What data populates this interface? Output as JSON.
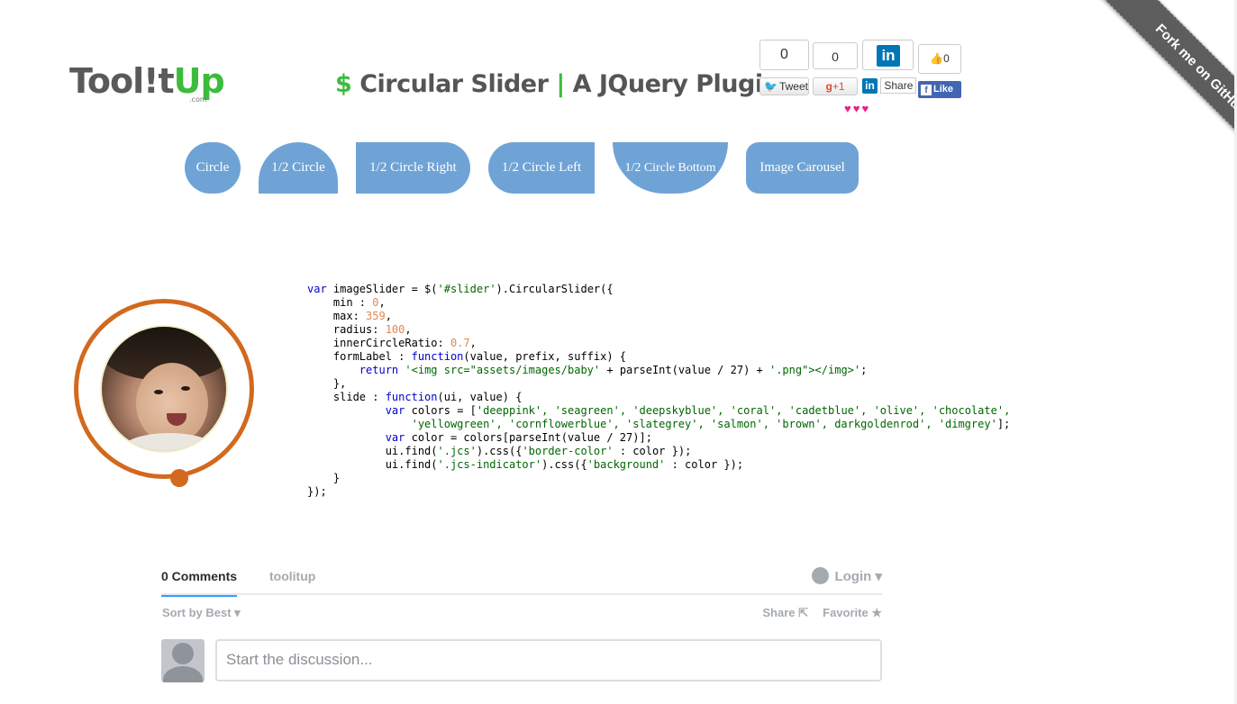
{
  "header": {
    "logo_tool": "Tool!t",
    "logo_up": "Up",
    "logo_com": ".com",
    "title_dollar": "$",
    "title_name": " Circular Slider ",
    "title_pipe": "|",
    "title_sub": " A JQuery Plugin"
  },
  "social": {
    "tweet_count": "0",
    "tweet_label": "Tweet",
    "gplus_count": "0",
    "gplus_label": "+1",
    "linkedin_label": "Share",
    "fb_count": "0",
    "fb_like_label": "Like",
    "hearts": "♥♥♥"
  },
  "ribbon": {
    "label": "Fork me on GitHub"
  },
  "nav": {
    "circle": "Circle",
    "half": "1/2 Circle",
    "right": "1/2 Circle Right",
    "left": "1/2 Circle Left",
    "bottom": "1/2 Circle Bottom",
    "carousel": "Image Carousel"
  },
  "slider": {
    "ring_color": "#d2691e",
    "value": 0
  },
  "code": {
    "l1a": "var",
    "l1b": " imageSlider = $(",
    "l1c": "'#slider'",
    "l1d": ").CircularSlider({",
    "l2a": "    min : ",
    "l2b": "0",
    "l2c": ",",
    "l3a": "    max: ",
    "l3b": "359",
    "l3c": ",",
    "l4a": "    radius: ",
    "l4b": "100",
    "l4c": ",",
    "l5a": "    innerCircleRatio: ",
    "l5b": "0.7",
    "l5c": ",",
    "l6a": "    formLabel : ",
    "l6b": "function",
    "l6c": "(value, prefix, suffix) {",
    "l7a": "        ",
    "l7b": "return",
    "l7c": " ",
    "l7d": "'<img src=\"assets/images/baby'",
    "l7e": " + parseInt(value / 27) + ",
    "l7f": "'.png\"></img>'",
    "l7g": ";",
    "l8": "    },",
    "l9a": "    slide : ",
    "l9b": "function",
    "l9c": "(ui, value) {",
    "l10a": "            ",
    "l10b": "var",
    "l10c": " colors = [",
    "l10d": "'deeppink', 'seagreen', 'deepskyblue', 'coral', 'cadetblue', 'olive', 'chocolate',",
    "l11a": "                ",
    "l11b": "'yellowgreen', 'cornflowerblue', 'slategrey', 'salmon', 'brown', darkgoldenrod', 'dimgrey'",
    "l11c": "];",
    "l12a": "            ",
    "l12b": "var",
    "l12c": " color = colors[parseInt(value / 27)];",
    "l13a": "            ui.find(",
    "l13b": "'.jcs'",
    "l13c": ").css({",
    "l13d": "'border-color'",
    "l13e": " : color });",
    "l14a": "            ui.find(",
    "l14b": "'.jcs-indicator'",
    "l14c": ").css({",
    "l14d": "'background'",
    "l14e": " : color });",
    "l15": "    }",
    "l16": "});"
  },
  "comments": {
    "count_tab": "0 Comments",
    "site_tab": "toolitup",
    "login": "Login ▾",
    "sort": "Sort by Best ▾",
    "share": "Share ⇱",
    "favorite": "Favorite ★",
    "placeholder": "Start the discussion..."
  },
  "colors": {
    "accent_green": "#3dbb3d",
    "nav_blue": "#6fa3d6",
    "slider_orange": "#d2691e"
  }
}
